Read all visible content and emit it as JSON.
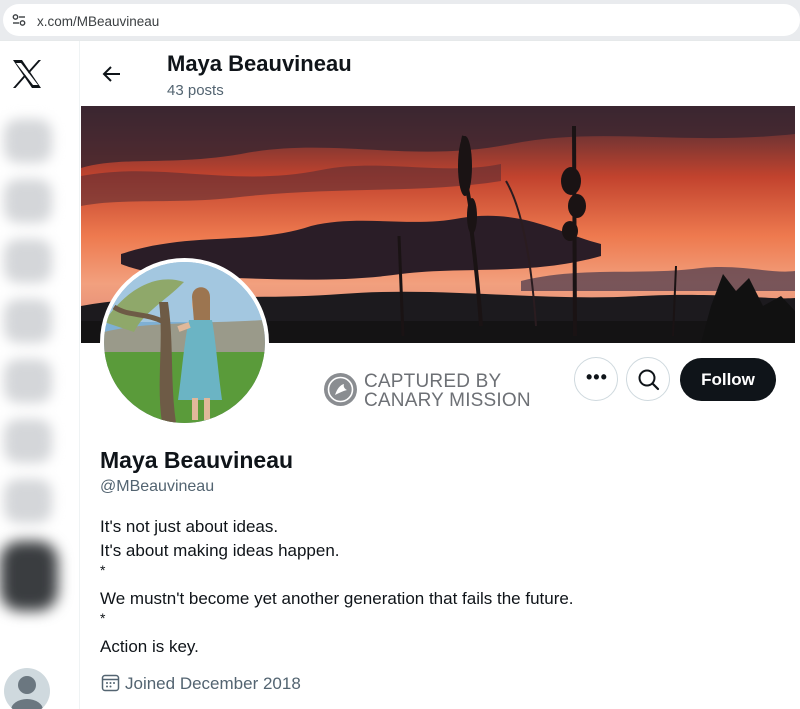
{
  "browser": {
    "url": "x.com/MBeauvineau"
  },
  "header": {
    "name": "Maya Beauvineau",
    "posts": "43 posts"
  },
  "stamp": {
    "line1": "CAPTURED BY",
    "line2": "CANARY MISSION"
  },
  "actions": {
    "more_label": "•••",
    "follow_label": "Follow"
  },
  "profile": {
    "name": "Maya Beauvineau",
    "handle": "@MBeauvineau",
    "bio": [
      "It's not just about ideas.",
      "It's about making ideas happen.",
      "*",
      "We mustn't become yet another generation that fails the future.",
      "*",
      "Action is key."
    ],
    "joined": "Joined December 2018"
  },
  "icons": [
    "site-settings-icon",
    "x-logo-icon",
    "back-arrow-icon",
    "canary-bird-icon",
    "more-icon",
    "search-icon",
    "calendar-icon",
    "default-avatar-icon"
  ],
  "colors": {
    "follow_bg": "#0f1419",
    "secondary_text": "#536471",
    "stamp_gray": "#6d7075"
  }
}
